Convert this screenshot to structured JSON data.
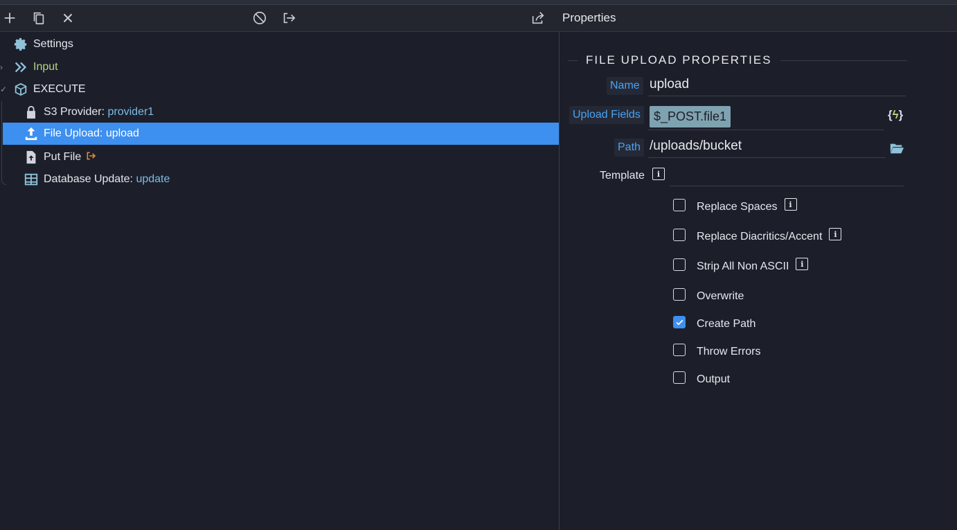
{
  "header": {
    "properties_title": "Properties"
  },
  "toolbar": {
    "add_icon": "plus-icon",
    "duplicate_icon": "copy-icon",
    "remove_icon": "close-icon",
    "disable_icon": "ban-icon",
    "export_icon": "sign-out-icon",
    "share_icon": "share-icon"
  },
  "tree": {
    "settings": {
      "label": "Settings"
    },
    "input": {
      "label": "Input"
    },
    "execute": {
      "label": "EXECUTE"
    },
    "items": [
      {
        "prefix": "S3 Provider: ",
        "value": "provider1",
        "icon": "lock-icon"
      },
      {
        "prefix": "File Upload: ",
        "value": "upload",
        "icon": "upload-icon"
      },
      {
        "prefix": "Put File",
        "value": "",
        "icon": "file-upload-icon"
      },
      {
        "prefix": "Database Update: ",
        "value": "update",
        "icon": "table-icon"
      }
    ]
  },
  "props": {
    "section_title": "FILE UPLOAD PROPERTIES",
    "name_label": "Name",
    "name_value": "upload",
    "upload_fields_label": "Upload Fields",
    "upload_fields_value": "$_POST.file1",
    "path_label": "Path",
    "path_value": "/uploads/bucket",
    "template_label": "Template",
    "template_value": "",
    "checkboxes": [
      {
        "label": "Replace Spaces",
        "checked": false,
        "info": true
      },
      {
        "label": "Replace Diacritics/Accent",
        "checked": false,
        "info": true
      },
      {
        "label": "Strip All Non ASCII",
        "checked": false,
        "info": true
      },
      {
        "label": "Overwrite",
        "checked": false,
        "info": false
      },
      {
        "label": "Create Path",
        "checked": true,
        "info": false
      },
      {
        "label": "Throw Errors",
        "checked": false,
        "info": false
      },
      {
        "label": "Output",
        "checked": false,
        "info": false
      }
    ]
  },
  "colors": {
    "accent": "#3d8ff0",
    "panel": "#1c1f2a",
    "label_blue": "#4aa3f5",
    "value_blue": "#7bbce6",
    "input_green": "#b6d47e",
    "chip": "#7fa2b0"
  }
}
